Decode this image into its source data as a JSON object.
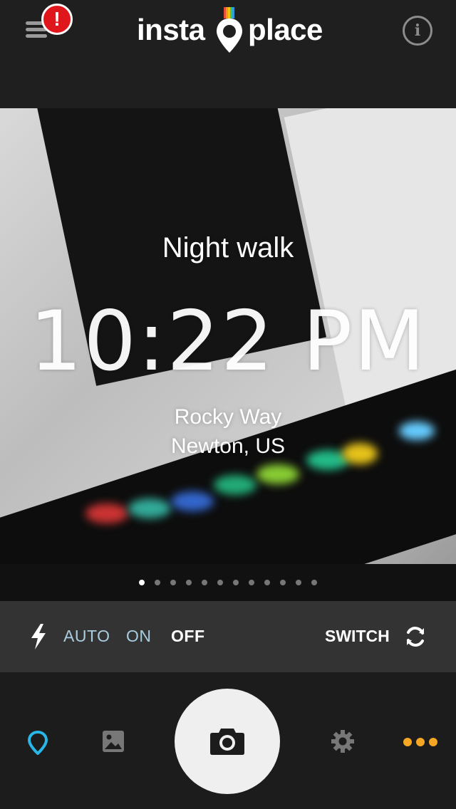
{
  "header": {
    "alert_badge": "!",
    "logo_left": "insta",
    "logo_right": "place",
    "info_label": "i"
  },
  "overlay": {
    "title": "Night walk",
    "time": "10:22 PM",
    "street": "Rocky Way",
    "city": "Newton, US"
  },
  "pager": {
    "count": 12,
    "active_index": 0
  },
  "flash": {
    "options": [
      "AUTO",
      "ON",
      "OFF"
    ],
    "selected": "OFF",
    "switch_label": "SWITCH"
  },
  "toolbar": {
    "icons": [
      "location-pin-icon",
      "gallery-icon",
      "camera-icon",
      "settings-gear-icon",
      "more-icon"
    ],
    "accent_color": "#29b6e8",
    "more_color": "#f5a623"
  }
}
